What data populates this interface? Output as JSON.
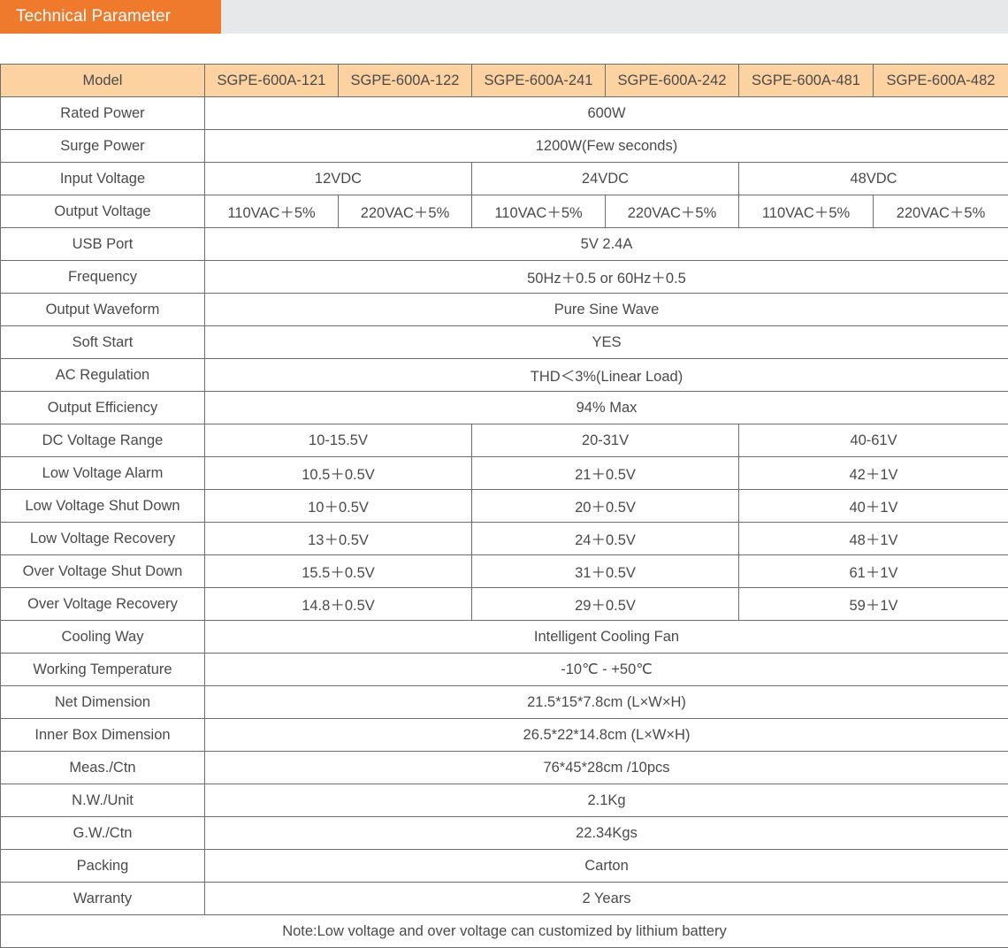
{
  "banner": {
    "tab_label": "Technical Parameter",
    "tab_color": "#ef7a2c",
    "bar_color": "#e6e8ea"
  },
  "table": {
    "header_bg": "#fcd2a1",
    "border_color": "#6e6e6e",
    "label_column_header": "Model",
    "models": [
      "SGPE-600A-121",
      "SGPE-600A-122",
      "SGPE-600A-241",
      "SGPE-600A-242",
      "SGPE-600A-481",
      "SGPE-600A-482"
    ],
    "rows": [
      {
        "label": "Rated Power",
        "span": "full",
        "values": [
          "600W"
        ]
      },
      {
        "label": "Surge Power",
        "span": "full",
        "values": [
          "1200W(Few seconds)"
        ]
      },
      {
        "label": "Input Voltage",
        "span": "group",
        "values": [
          "12VDC",
          "24VDC",
          "48VDC"
        ]
      },
      {
        "label": "Output Voltage",
        "span": "each",
        "values": [
          "110VAC＋5%",
          "220VAC＋5%",
          "110VAC＋5%",
          "220VAC＋5%",
          "110VAC＋5%",
          "220VAC＋5%"
        ]
      },
      {
        "label": "USB Port",
        "span": "full",
        "values": [
          "5V 2.4A"
        ]
      },
      {
        "label": "Frequency",
        "span": "full",
        "values": [
          "50Hz＋0.5 or 60Hz＋0.5"
        ]
      },
      {
        "label": "Output Waveform",
        "span": "full",
        "values": [
          "Pure Sine Wave"
        ]
      },
      {
        "label": "Soft Start",
        "span": "full",
        "values": [
          "YES"
        ]
      },
      {
        "label": "AC Regulation",
        "span": "full",
        "values": [
          "THD＜3%(Linear Load)"
        ]
      },
      {
        "label": "Output Efficiency",
        "span": "full",
        "values": [
          "94% Max"
        ]
      },
      {
        "label": "DC Voltage Range",
        "span": "group",
        "values": [
          "10-15.5V",
          "20-31V",
          "40-61V"
        ]
      },
      {
        "label": "Low Voltage Alarm",
        "span": "group",
        "values": [
          "10.5＋0.5V",
          "21＋0.5V",
          "42＋1V"
        ]
      },
      {
        "label": "Low Voltage Shut Down",
        "span": "group",
        "values": [
          "10＋0.5V",
          "20＋0.5V",
          "40＋1V"
        ]
      },
      {
        "label": "Low Voltage Recovery",
        "span": "group",
        "values": [
          "13＋0.5V",
          "24＋0.5V",
          "48＋1V"
        ]
      },
      {
        "label": "Over Voltage Shut Down",
        "span": "group",
        "values": [
          "15.5＋0.5V",
          "31＋0.5V",
          "61＋1V"
        ]
      },
      {
        "label": "Over Voltage Recovery",
        "span": "group",
        "values": [
          "14.8＋0.5V",
          "29＋0.5V",
          "59＋1V"
        ]
      },
      {
        "label": "Cooling Way",
        "span": "full",
        "values": [
          "Intelligent Cooling Fan"
        ]
      },
      {
        "label": "Working Temperature",
        "span": "full",
        "values": [
          "-10℃ - +50℃"
        ]
      },
      {
        "label": "Net Dimension",
        "span": "full",
        "values": [
          "21.5*15*7.8cm (L×W×H)"
        ]
      },
      {
        "label": "Inner Box Dimension",
        "span": "full",
        "values": [
          "26.5*22*14.8cm (L×W×H)"
        ]
      },
      {
        "label": "Meas./Ctn",
        "span": "full",
        "values": [
          "76*45*28cm /10pcs"
        ]
      },
      {
        "label": "N.W./Unit",
        "span": "full",
        "values": [
          "2.1Kg"
        ]
      },
      {
        "label": "G.W./Ctn",
        "span": "full",
        "values": [
          "22.34Kgs"
        ]
      },
      {
        "label": "Packing",
        "span": "full",
        "values": [
          "Carton"
        ]
      },
      {
        "label": "Warranty",
        "span": "full",
        "values": [
          "2 Years"
        ]
      }
    ],
    "note": "Note:Low voltage and over voltage can customized by lithium battery",
    "note_color": "#e8883e"
  }
}
